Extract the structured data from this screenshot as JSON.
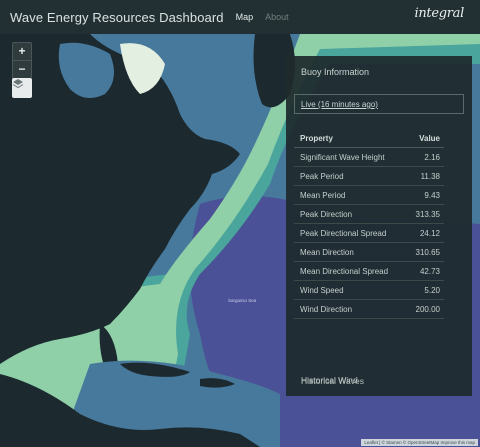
{
  "header": {
    "title": "Wave Energy Resources Dashboard",
    "nav": [
      {
        "label": "Map",
        "active": true
      },
      {
        "label": "About",
        "active": false
      }
    ],
    "logo_text": "integral"
  },
  "map": {
    "zoom_in_label": "+",
    "zoom_out_label": "−",
    "layers_icon": "layers-icon",
    "place_label": "Sargasso Sea",
    "attribution": "Leaflet | © Stamen © OpenStreetMap Improve this map",
    "colors": {
      "land": "#1c2a30",
      "deep_ocean": "#4b5196",
      "mid_ocean": "#47799c",
      "shelf": "#4aa59c",
      "shallow": "#8fd0a8",
      "coast": "#cfeaa8"
    }
  },
  "buoy_panel": {
    "title": "Buoy Information",
    "live_label": "Live (16 minutes ago)",
    "columns": {
      "property": "Property",
      "value": "Value"
    },
    "rows": [
      {
        "property": "Significant Wave Height",
        "value": "2.16"
      },
      {
        "property": "Peak Period",
        "value": "11.38"
      },
      {
        "property": "Mean Period",
        "value": "9.43"
      },
      {
        "property": "Peak Direction",
        "value": "313.35"
      },
      {
        "property": "Peak Directional Spread",
        "value": "24.12"
      },
      {
        "property": "Mean Direction",
        "value": "310.65"
      },
      {
        "property": "Mean Directional Spread",
        "value": "42.73"
      },
      {
        "property": "Wind Speed",
        "value": "5.20"
      },
      {
        "property": "Wind Direction",
        "value": "200.00"
      }
    ],
    "historical_waves": "Historical Waves",
    "historical_wind": "Historical Wind"
  }
}
